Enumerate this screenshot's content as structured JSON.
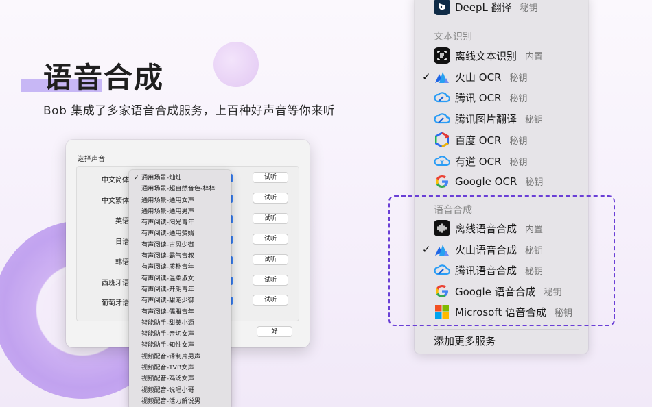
{
  "hero": {
    "title": "语音合成",
    "subtitle": "Bob 集成了多家语音合成服务，上百种好声音等你来听"
  },
  "dialog": {
    "title": "选择声音",
    "languages": [
      "中文简体",
      "中文繁体",
      "英语",
      "日语",
      "韩语",
      "西班牙语",
      "葡萄牙语"
    ],
    "try_label": "试听",
    "ok_label": "好"
  },
  "voice_menu": {
    "selected_index": 0,
    "items": [
      "通用场景-灿灿",
      "通用场景-超自然音色-梓梓",
      "通用场景-通用女声",
      "通用场景-通用男声",
      "有声阅读-阳光青年",
      "有声阅读-通用赘婿",
      "有声阅读-古风少御",
      "有声阅读-霸气青叔",
      "有声阅读-质朴青年",
      "有声阅读-温柔淑女",
      "有声阅读-开朗青年",
      "有声阅读-甜宠少御",
      "有声阅读-儒雅青年",
      "智能助手-甜美小源",
      "智能助手-亲切女声",
      "智能助手-知性女声",
      "视频配音-译制片男声",
      "视频配音-TVB女声",
      "视频配音-鸡汤女声",
      "视频配音-说唱小哥",
      "视频配音-活力解说男"
    ]
  },
  "service_menu": {
    "top_item": {
      "name": "DeepL 翻译",
      "badge": "秘钥",
      "icon": "deepl-icon"
    },
    "ocr_header": "文本识别",
    "ocr_items": [
      {
        "name": "离线文本识别",
        "badge": "内置",
        "icon": "scan-icon",
        "checked": false
      },
      {
        "name": "火山 OCR",
        "badge": "秘钥",
        "icon": "volcano-icon",
        "checked": true
      },
      {
        "name": "腾讯 OCR",
        "badge": "秘钥",
        "icon": "tencent-cloud-icon",
        "checked": false
      },
      {
        "name": "腾讯图片翻译",
        "badge": "秘钥",
        "icon": "tencent-cloud-icon",
        "checked": false
      },
      {
        "name": "百度 OCR",
        "badge": "秘钥",
        "icon": "baidu-cloud-icon",
        "checked": false
      },
      {
        "name": "有道 OCR",
        "badge": "秘钥",
        "icon": "youdao-cloud-icon",
        "checked": false
      },
      {
        "name": "Google OCR",
        "badge": "秘钥",
        "icon": "google-icon",
        "checked": false
      }
    ],
    "tts_header": "语音合成",
    "tts_items": [
      {
        "name": "离线语音合成",
        "badge": "内置",
        "icon": "waveform-icon",
        "checked": false
      },
      {
        "name": "火山语音合成",
        "badge": "秘钥",
        "icon": "volcano-icon",
        "checked": true
      },
      {
        "name": "腾讯语音合成",
        "badge": "秘钥",
        "icon": "tencent-cloud-icon",
        "checked": false
      },
      {
        "name": "Google 语音合成",
        "badge": "秘钥",
        "icon": "google-icon",
        "checked": false
      },
      {
        "name": "Microsoft 语音合成",
        "badge": "秘钥",
        "icon": "microsoft-icon",
        "checked": false
      }
    ],
    "add_more": "添加更多服务"
  },
  "colors": {
    "accent": "#6a3fd6",
    "select_blue": "#3b82f6",
    "menu_bg": "#e6e4e8"
  }
}
